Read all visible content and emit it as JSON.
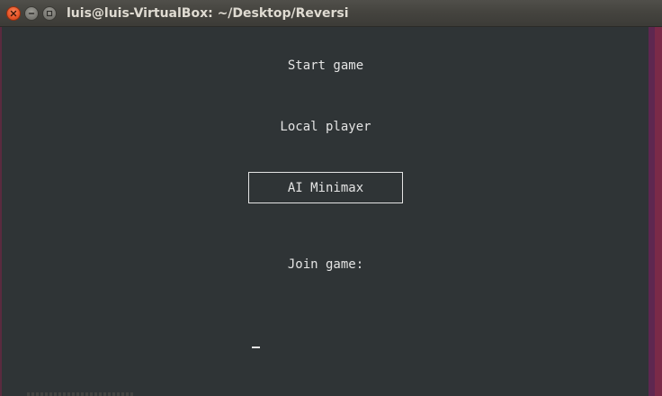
{
  "window": {
    "title": "luis@luis-VirtualBox: ~/Desktop/Reversi"
  },
  "menu": {
    "start_game": "Start game",
    "local_player": "Local player",
    "ai_minimax": "AI Minimax",
    "join_game": "Join game:",
    "selected": "AI Minimax"
  },
  "colors": {
    "terminal_bg": "#2f3436",
    "text": "#e4e4e4",
    "close_button": "#e9572a",
    "scrollbar_accent": "#5e2750"
  },
  "icons": {
    "close": "close-icon",
    "minimize": "minimize-icon",
    "maximize": "maximize-icon"
  }
}
